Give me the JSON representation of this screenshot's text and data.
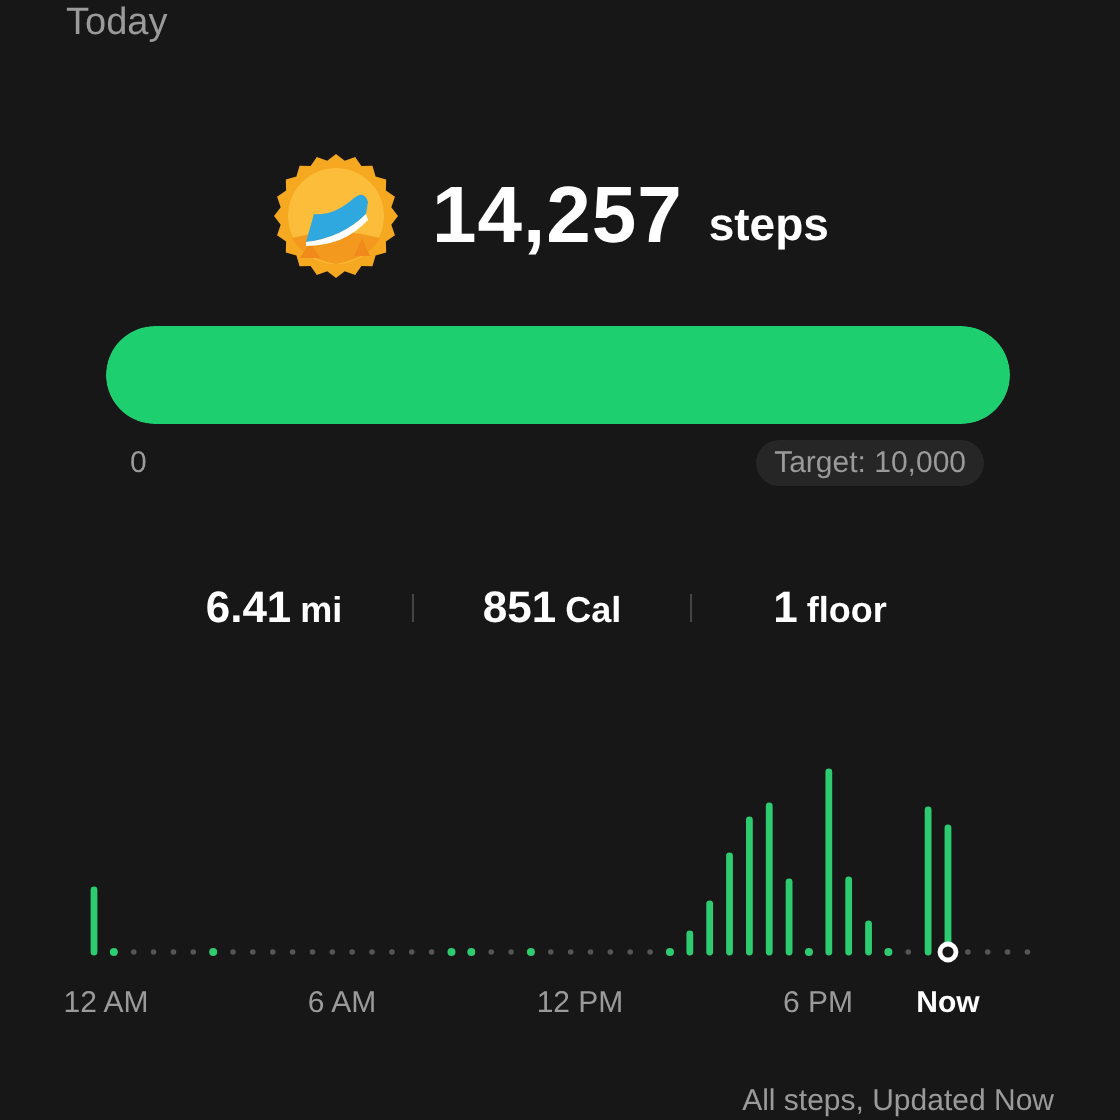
{
  "header": {
    "title": "Today"
  },
  "steps": {
    "count": "14,257",
    "unit": "steps"
  },
  "progress": {
    "level": 1,
    "min_label": "0",
    "target": "Target: 10,000"
  },
  "stats": [
    {
      "value": "6.41",
      "unit": "mi"
    },
    {
      "value": "851",
      "unit": "Cal"
    },
    {
      "value": "1",
      "unit": "floor"
    }
  ],
  "chart": {
    "axis_labels": [
      {
        "text": "12 AM",
        "kind": "time"
      },
      {
        "text": "6 AM",
        "kind": "time"
      },
      {
        "text": "12 PM",
        "kind": "time"
      },
      {
        "text": "6 PM",
        "kind": "time"
      },
      {
        "text": "Now",
        "kind": "current"
      }
    ]
  },
  "footer": {
    "text": "All steps, Updated Now"
  }
}
